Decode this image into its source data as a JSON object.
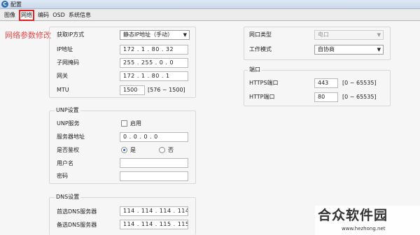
{
  "window": {
    "title": "配置",
    "app_icon": "C"
  },
  "tabs": [
    {
      "label": "图像"
    },
    {
      "label": "网络",
      "active": true
    },
    {
      "label": "编码"
    },
    {
      "label": "OSD"
    },
    {
      "label": "系统信息"
    }
  ],
  "annotation": {
    "text": "网络参数修改",
    "color": "#e34848"
  },
  "ip_section": {
    "ip_mode_label": "获取IP方式",
    "ip_mode_value": "静态IP地址（手动）",
    "ip_label": "IP地址",
    "ip_value": "172 . 1 . 80 . 32",
    "mask_label": "子网掩码",
    "mask_value": "255 . 255 . 0 . 0",
    "gateway_label": "网关",
    "gateway_value": "172 . 1 . 80 . 1",
    "mtu_label": "MTU",
    "mtu_value": "1500",
    "mtu_range": "[576 ~ 1500]"
  },
  "unp_section": {
    "title": "UNP设置",
    "service_label": "UNP服务",
    "enable_label": "启用",
    "server_label": "服务器地址",
    "server_value": "0 . 0 . 0 . 0",
    "auth_label": "是否鉴权",
    "yes_label": "是",
    "no_label": "否",
    "username_label": "用户名",
    "username_value": "",
    "password_label": "密码",
    "password_value": ""
  },
  "dns_section": {
    "title": "DNS设置",
    "primary_label": "首选DNS服务器",
    "primary_value": "114 . 114 . 114 . 114",
    "secondary_label": "备选DNS服务器",
    "secondary_value": "114 . 114 . 115 . 115"
  },
  "port_section": {
    "net_type_label": "网口类型",
    "net_type_value": "电口",
    "work_mode_label": "工作模式",
    "work_mode_value": "自协商",
    "ports_title": "端口",
    "https_label": "HTTPS端口",
    "https_value": "443",
    "https_range": "[0 ~ 65535]",
    "http_label": "HTTP端口",
    "http_value": "80",
    "http_range": "[0 ~ 65535]"
  },
  "watermark": {
    "logo": "合众软件园",
    "url": "www.hezhong.net"
  }
}
